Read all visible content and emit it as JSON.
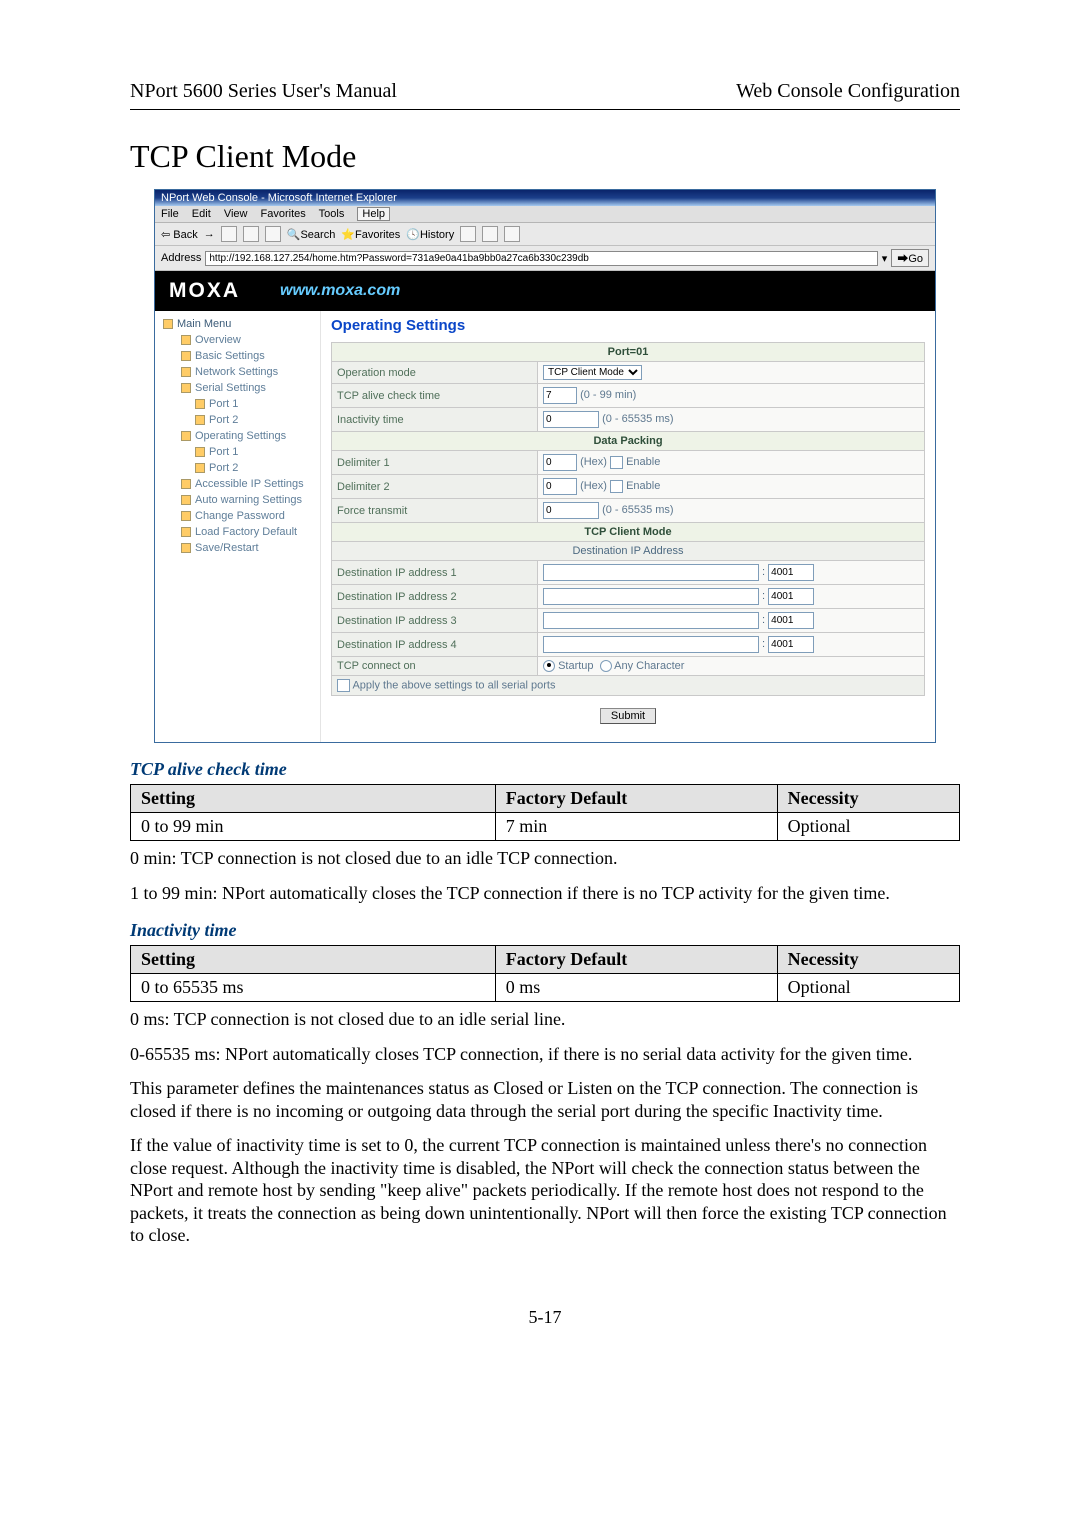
{
  "header": {
    "left": "NPort 5600 Series User's Manual",
    "right": "Web Console Configuration"
  },
  "sectionTitle": "TCP Client Mode",
  "ie": {
    "windowTitle": "NPort Web Console - Microsoft Internet Explorer",
    "menus": [
      "File",
      "Edit",
      "View",
      "Favorites",
      "Tools",
      "Help"
    ],
    "toolbar": {
      "back": "Back",
      "tb_search": "Search",
      "tb_fav": "Favorites",
      "tb_hist": "History"
    },
    "addressLabel": "Address",
    "addressValue": "http://192.168.127.254/home.htm?Password=731a9e0a41ba9bb0a27ca6b330c239db",
    "goLabel": "Go"
  },
  "banner": {
    "logo": "MOXA",
    "url": "www.moxa.com"
  },
  "sidebar": {
    "main": "Main Menu",
    "items": [
      "Overview",
      "Basic Settings",
      "Network Settings",
      "Serial Settings"
    ],
    "serialPorts": [
      "Port 1",
      "Port 2"
    ],
    "opSettings": "Operating Settings",
    "opPorts": [
      "Port 1",
      "Port 2"
    ],
    "rest": [
      "Accessible IP Settings",
      "Auto warning Settings",
      "Change Password",
      "Load Factory Default",
      "Save/Restart"
    ]
  },
  "content": {
    "heading": "Operating Settings",
    "bandPort": "Port=01",
    "rows": {
      "opMode": {
        "label": "Operation mode",
        "value": "TCP Client Mode"
      },
      "tcpAlive": {
        "label": "TCP alive check time",
        "value": "7",
        "hint": "(0 - 99 min)"
      },
      "inact": {
        "label": "Inactivity time",
        "value": "0",
        "hint": "(0 - 65535 ms)"
      }
    },
    "bandData": "Data Packing",
    "delim": {
      "d1": {
        "label": "Delimiter 1",
        "value": "0",
        "hint": "(Hex)",
        "enable": "Enable"
      },
      "d2": {
        "label": "Delimiter 2",
        "value": "0",
        "hint": "(Hex)",
        "enable": "Enable"
      },
      "force": {
        "label": "Force transmit",
        "value": "0",
        "hint": "(0 - 65535 ms)"
      }
    },
    "bandTcp": "TCP Client Mode",
    "destHdr": "Destination IP Address",
    "dest": [
      {
        "label": "Destination IP address 1",
        "port": "4001"
      },
      {
        "label": "Destination IP address 2",
        "port": "4001"
      },
      {
        "label": "Destination IP address 3",
        "port": "4001"
      },
      {
        "label": "Destination IP address 4",
        "port": "4001"
      }
    ],
    "tcpConnect": {
      "label": "TCP connect on",
      "opt1": "Startup",
      "opt2": "Any Character"
    },
    "applyAll": "Apply the above settings to all serial ports",
    "submit": "Submit"
  },
  "doc": {
    "sub1": "TCP alive check time",
    "table1": {
      "h1": "Setting",
      "h2": "Factory Default",
      "h3": "Necessity",
      "r1c1": "0 to 99 min",
      "r1c2": "7 min",
      "r1c3": "Optional"
    },
    "p1": "0 min: TCP connection is not closed due to an idle TCP connection.",
    "p2": "1 to 99 min: NPort automatically closes the TCP connection if there is no TCP activity for the given time.",
    "sub2": "Inactivity time",
    "table2": {
      "h1": "Setting",
      "h2": "Factory Default",
      "h3": "Necessity",
      "r1c1": "0 to 65535 ms",
      "r1c2": "0 ms",
      "r1c3": "Optional"
    },
    "p3": "0 ms: TCP connection is not closed due to an idle serial line.",
    "p4": "0-65535 ms: NPort automatically closes TCP connection, if there is no serial data activity for the given time.",
    "p5": "This parameter defines the maintenances status as Closed or Listen on the TCP connection. The connection is closed if there is no incoming or outgoing data through the serial port during the specific Inactivity time.",
    "p6": "If the value of inactivity time is set to 0, the current TCP connection is maintained unless there's no connection close request. Although the inactivity time is disabled, the NPort will check the connection status between the NPort and remote host by sending \"keep alive\" packets periodically. If the remote host does not respond to the packets, it treats the connection as being down unintentionally. NPort will then force the existing TCP connection to close.",
    "pagenum": "5-17"
  }
}
